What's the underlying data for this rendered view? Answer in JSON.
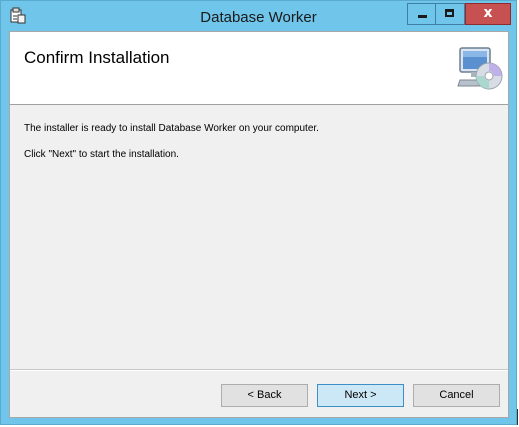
{
  "window": {
    "title": "Database Worker",
    "controls": {
      "minimize": "",
      "maximize": "",
      "close": "x"
    }
  },
  "banner": {
    "title": "Confirm Installation",
    "icon": "computer-disc-icon"
  },
  "body": {
    "line1": "The installer is ready to install Database Worker on your computer.",
    "line2": "Click \"Next\" to start the installation."
  },
  "buttons": {
    "back": "< Back",
    "next": "Next >",
    "cancel": "Cancel"
  },
  "colors": {
    "titlebar": "#6fc5ea",
    "close": "#c75050",
    "content_bg": "#f0f0f0"
  }
}
